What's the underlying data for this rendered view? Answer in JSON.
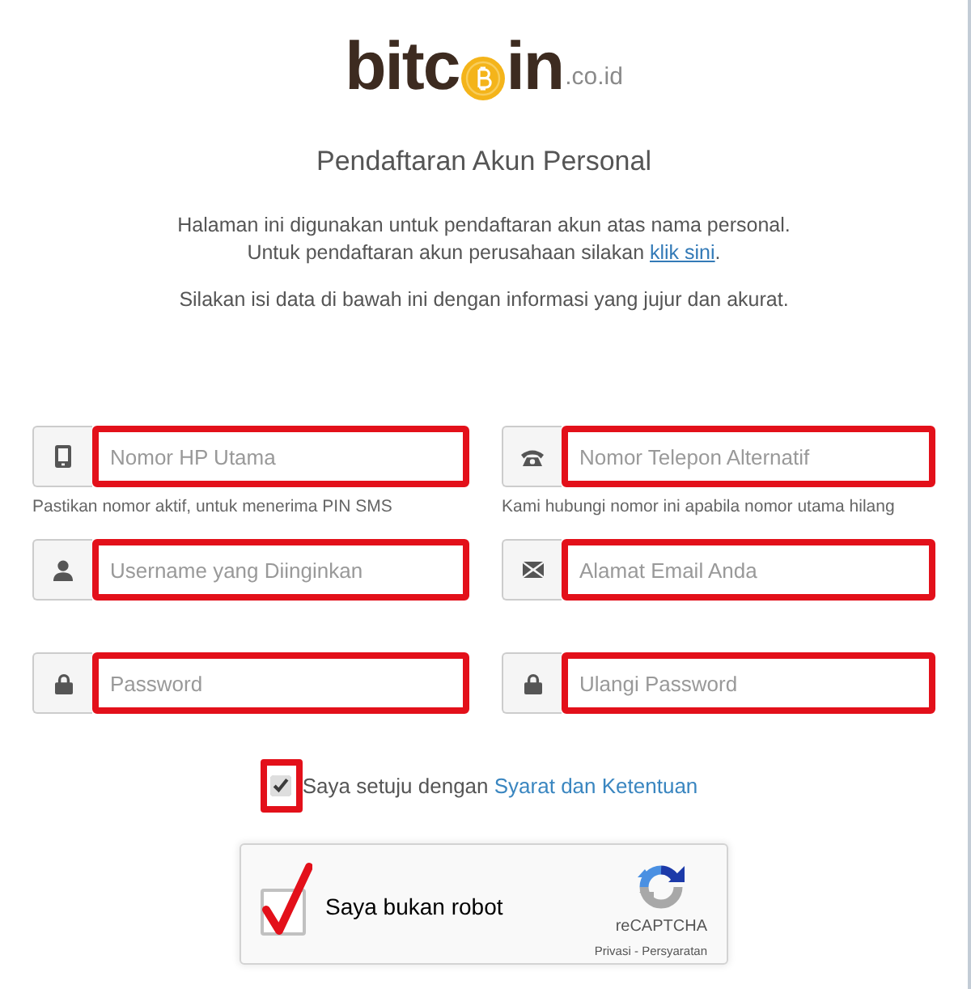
{
  "logo": {
    "brand_start": "bitc",
    "brand_end": "in",
    "domain": ".co.id"
  },
  "title": "Pendaftaran Akun Personal",
  "intro": {
    "line_1": "Halaman ini digunakan untuk pendaftaran akun atas nama personal.",
    "line_2": "Untuk pendaftaran akun perusahaan silakan",
    "link": "klik sini",
    "after_link": "."
  },
  "instruction": "Silakan isi data di bawah ini dengan informasi yang jujur dan akurat.",
  "fields": [
    {
      "kind": "mobile",
      "placeholder": "Nomor HP Utama",
      "help": "Pastikan nomor aktif, untuk menerima PIN SMS",
      "highlighted": true
    },
    {
      "kind": "phone",
      "placeholder": "Nomor Telepon Alternatif",
      "help": "Kami hubungi nomor ini apabila nomor utama hilang",
      "highlighted": true
    },
    {
      "kind": "username",
      "placeholder": "Username yang Diinginkan",
      "highlighted": true
    },
    {
      "kind": "email",
      "placeholder": "Alamat Email Anda",
      "highlighted": true
    },
    {
      "kind": "password",
      "placeholder": "Password",
      "highlighted": true
    },
    {
      "kind": "password",
      "placeholder": "Ulangi Password",
      "highlighted": true
    }
  ],
  "agree": {
    "checked": true,
    "highlighted": true,
    "text": "Saya setuju dengan",
    "link": "Syarat dan Ketentuan"
  },
  "captcha": {
    "checked": true,
    "label": "Saya bukan robot",
    "brand": "reCAPTCHA",
    "links": [
      "Privasi",
      "Persyaratan"
    ],
    "separator": "-"
  }
}
